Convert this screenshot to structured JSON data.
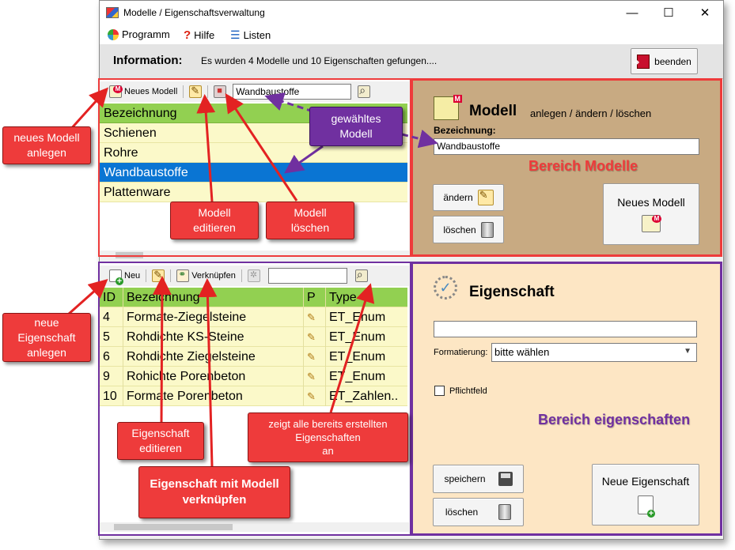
{
  "window": {
    "title": "Modelle / Eigenschaftsverwaltung",
    "controls": {
      "minimize": "—",
      "maximize": "☐",
      "close": "✕"
    }
  },
  "menu": [
    {
      "label": "Programm",
      "icon": "program-icon"
    },
    {
      "label": "Hilfe",
      "icon": "help-icon"
    },
    {
      "label": "Listen",
      "icon": "list-icon"
    }
  ],
  "info": {
    "label": "Information:",
    "message": "Es wurden  4  Modelle  und 10  Eigenschaften gefungen....",
    "exit_button": "beenden"
  },
  "model_panel": {
    "toolbar": {
      "new_label": "Neues Modell",
      "search_value": "Wandbaustoffe"
    },
    "list_header": "Bezeichnung",
    "items": [
      "Schienen",
      "Rohre",
      "Wandbaustoffe",
      "Plattenware"
    ],
    "selected_index": 2
  },
  "property_panel": {
    "toolbar": {
      "new_label": "Neu",
      "link_label": "Verknüpfen",
      "search_value": ""
    },
    "columns": [
      "ID",
      "Bezeichnung",
      "P",
      "Type"
    ],
    "rows": [
      {
        "id": "4",
        "name": "Formate-Ziegelsteine",
        "type": "ET_Enum"
      },
      {
        "id": "5",
        "name": "Rohdichte KS-Steine",
        "type": "ET_Enum"
      },
      {
        "id": "6",
        "name": "Rohdichte Ziegelsteine",
        "type": "ET_Enum"
      },
      {
        "id": "9",
        "name": "Rohichte Porenbeton",
        "type": "ET_Enum"
      },
      {
        "id": "10",
        "name": "Formate Porenbeton",
        "type": "ET_Zahlen.."
      }
    ]
  },
  "model_form": {
    "title": "Modell",
    "subtitle": "anlegen / ändern / löschen",
    "field_label": "Bezeichnung:",
    "field_value": "Wandbaustoffe",
    "region_label": "Bereich Modelle",
    "change_button": "ändern",
    "delete_button": "löschen",
    "new_button": "Neues  Modell"
  },
  "property_form": {
    "title": "Eigenschaft",
    "name_value": "",
    "format_label": "Formatierung:",
    "format_value": "bitte wählen",
    "required_label": "Pflichtfeld",
    "region_label": "Bereich eigenschaften",
    "save_button": "speichern",
    "delete_button": "löschen",
    "new_button": "Neue Eigenschaft"
  },
  "annotations": {
    "new_model": "neues Modell\nanlegen",
    "edit_model": "Modell\neditieren",
    "delete_model": "Modell\nlöschen",
    "selected_model": "gewähltes\nModell",
    "new_property": "neue\nEigenschaft\nanlegen",
    "edit_property": "Eigenschaft\neditieren",
    "link_property": "Eigenschaft mit Modell\nverknüpfen",
    "show_all": "zeigt alle bereits erstellten\nEigenschaften\nan"
  },
  "colors": {
    "list_row": "#fbf9c9",
    "list_header": "#92d051",
    "selected_row": "#0a75d3",
    "model_area": "#c8aa82",
    "property_area": "#fde6c4",
    "callout_red": "#ee3b3b",
    "callout_purple": "#7030a0",
    "model_region_text": "#ee3b3b",
    "property_region_text": "#7030a0"
  }
}
